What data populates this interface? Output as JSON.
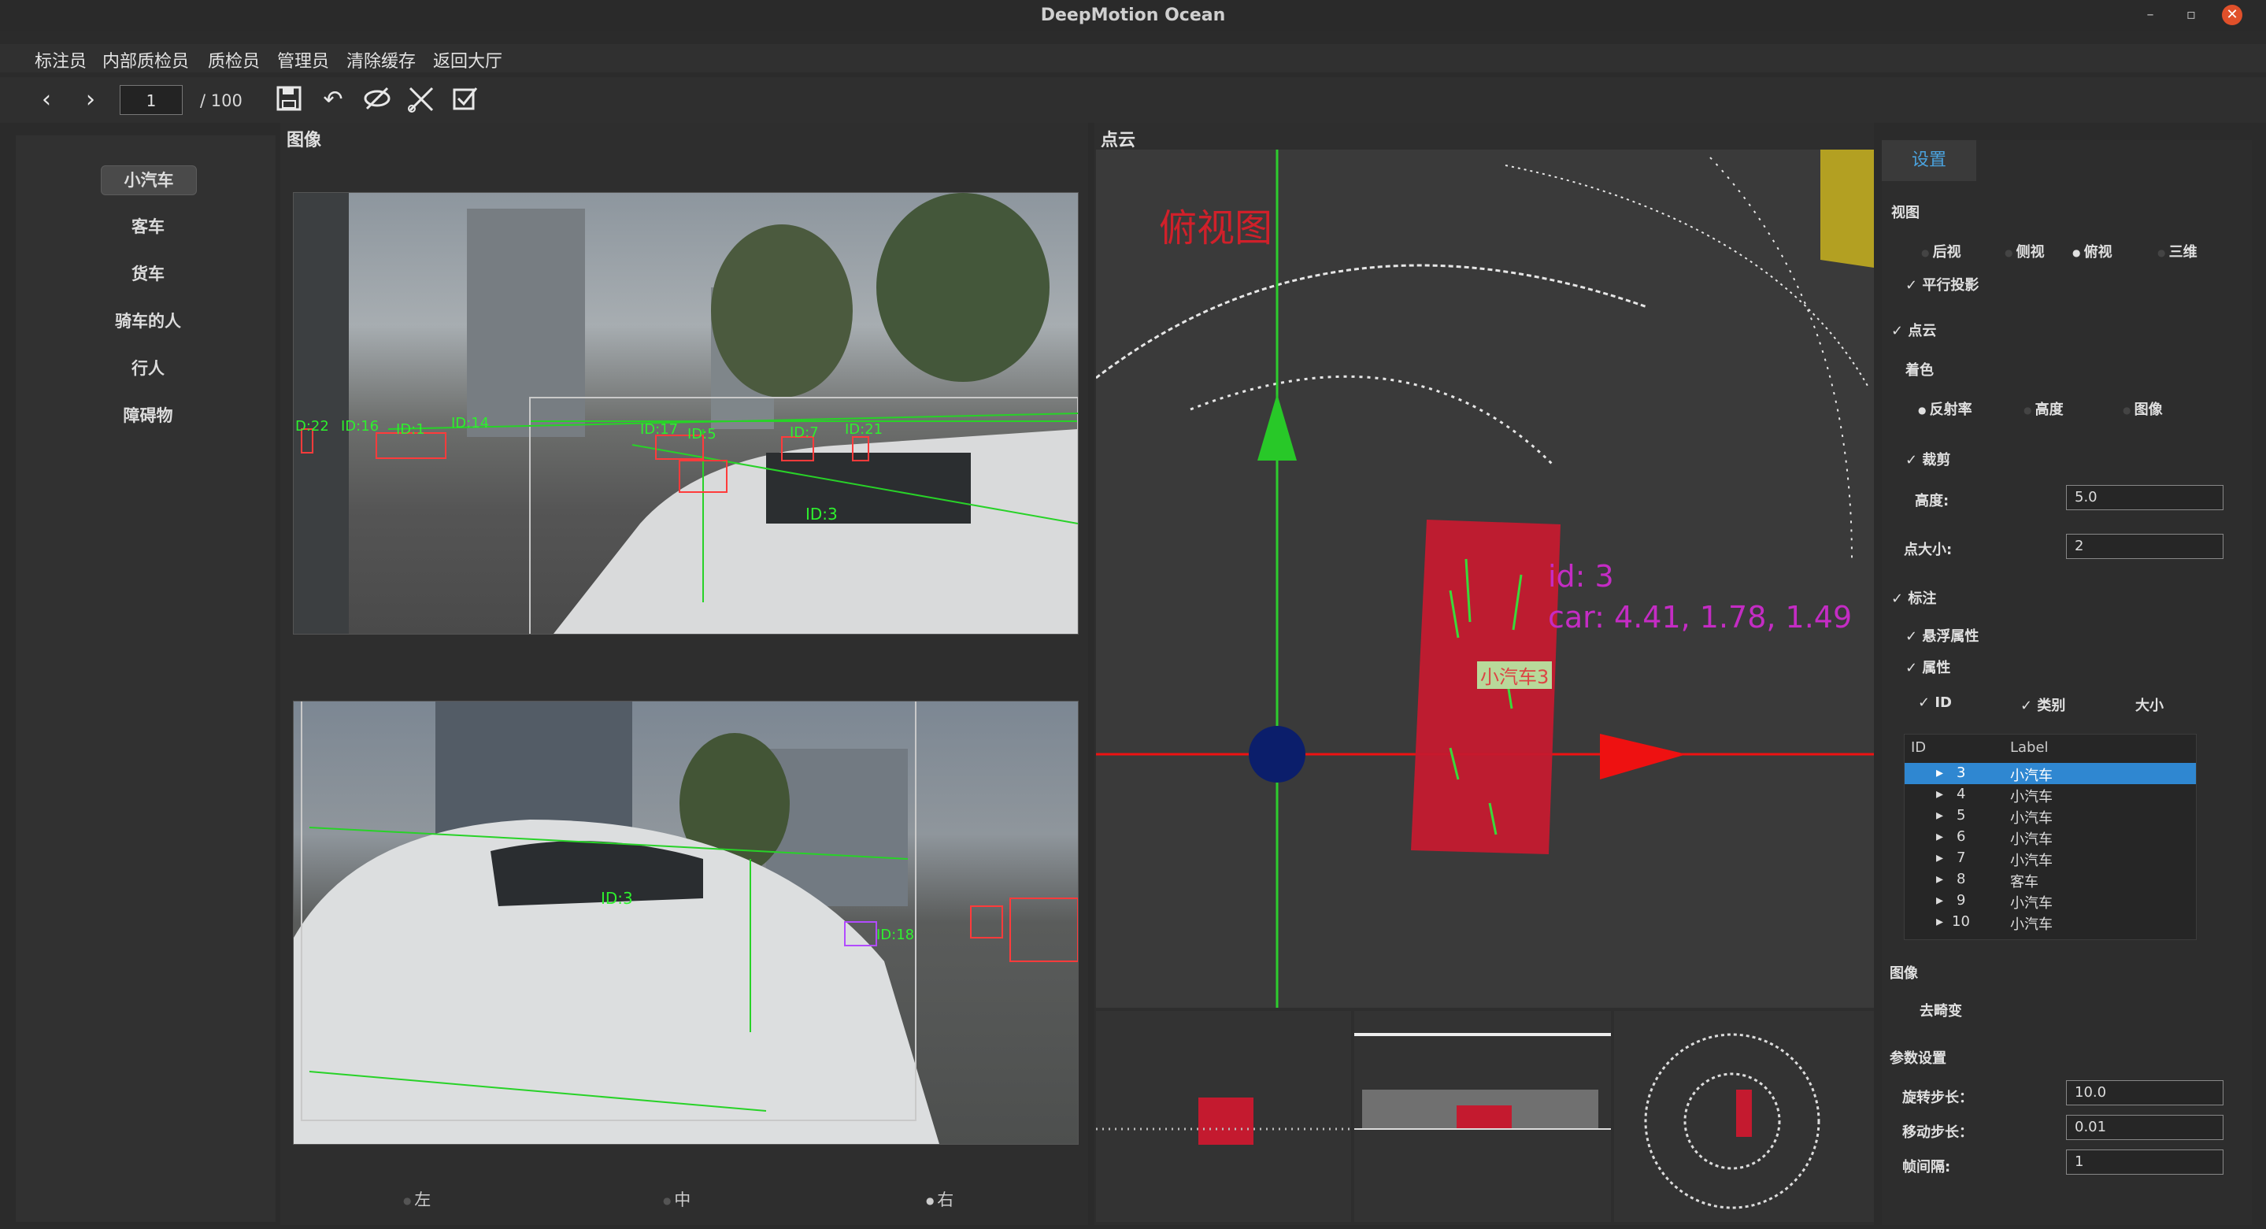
{
  "window": {
    "title": "DeepMotion Ocean"
  },
  "menu": [
    "标注员",
    "内部质检员",
    "质检员",
    "管理员",
    "清除缓存",
    "返回大厅"
  ],
  "toolbar": {
    "frame_value": "1",
    "frame_total": "/ 100",
    "icons": [
      "prev-icon",
      "next-icon",
      "save-icon",
      "undo-icon",
      "hide-icon",
      "cut-icon",
      "check-icon"
    ]
  },
  "categories": [
    "小汽车",
    "客车",
    "货车",
    "骑车的人",
    "行人",
    "障碍物"
  ],
  "image_panel": {
    "title": "图像",
    "camera_labels_top": [
      "D:22",
      "ID:16",
      "ID:1",
      "ID:14",
      "ID:17",
      "ID:5",
      "ID:7",
      "ID:21",
      "ID:3"
    ],
    "camera_labels_bottom": [
      "ID:3",
      "ID:18"
    ],
    "view_options": [
      "左",
      "中",
      "右"
    ],
    "selected_view": "右"
  },
  "pointcloud_panel": {
    "title": "点云",
    "view_label": "俯视图",
    "object_id": "id: 3",
    "object_dims": "car: 4.41, 1.78, 1.49",
    "object_tag": "小汽车3"
  },
  "settings": {
    "tab": "设置",
    "view_section": "视图",
    "view_options": [
      "后视",
      "侧视",
      "俯视",
      "三维"
    ],
    "selected_view": "俯视",
    "parallel_projection": "平行投影",
    "pointcloud_section": "点云",
    "color_label": "着色",
    "color_options": [
      "反射率",
      "高度",
      "图像"
    ],
    "selected_color": "反射率",
    "crop_label": "裁剪",
    "height_label": "高度:",
    "height_value": "5.0",
    "point_size_label": "点大小:",
    "point_size_value": "2",
    "annotation_section": "标注",
    "hover_attr": "悬浮属性",
    "attr_label": "属性",
    "attr_options": [
      "ID",
      "类别",
      "大小"
    ],
    "tree_headers": [
      "ID",
      "Label"
    ],
    "tree_rows": [
      {
        "id": "3",
        "label": "小汽车"
      },
      {
        "id": "4",
        "label": "小汽车"
      },
      {
        "id": "5",
        "label": "小汽车"
      },
      {
        "id": "6",
        "label": "小汽车"
      },
      {
        "id": "7",
        "label": "小汽车"
      },
      {
        "id": "8",
        "label": "客车"
      },
      {
        "id": "9",
        "label": "小汽车"
      },
      {
        "id": "10",
        "label": "小汽车"
      }
    ],
    "image_section": "图像",
    "undistort": "去畸变",
    "param_section": "参数设置",
    "rotate_step_label": "旋转步长：",
    "rotate_step_value": "10.0",
    "move_step_label": "移动步长：",
    "move_step_value": "0.01",
    "frame_interval_label": "帧间隔:",
    "frame_interval_value": "1"
  }
}
